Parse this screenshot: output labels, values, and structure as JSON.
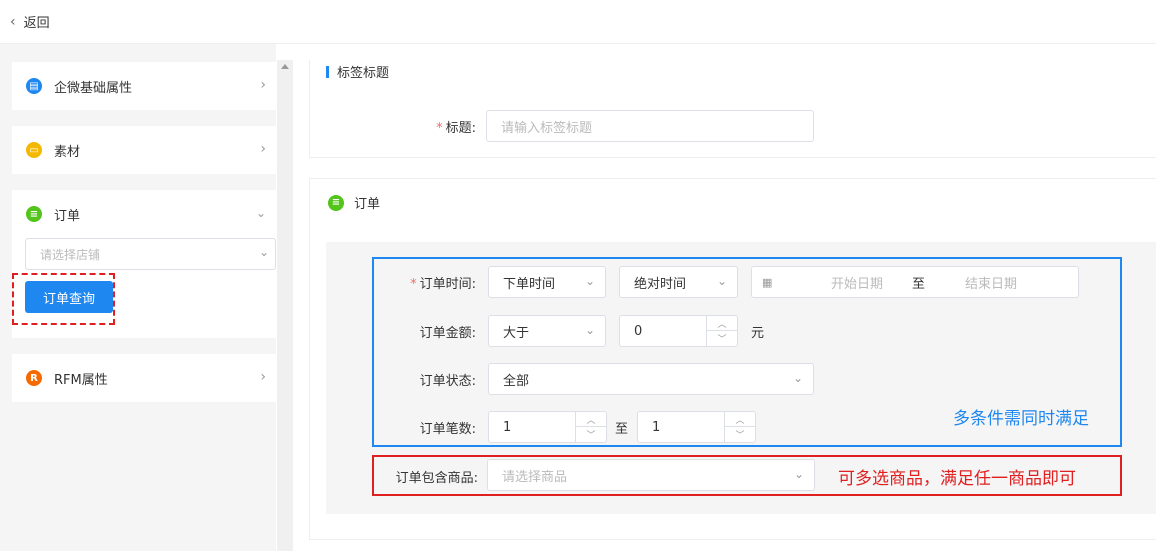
{
  "header": {
    "back_label": "返回"
  },
  "sidebar": {
    "cards": [
      {
        "label": "企微基础属性",
        "color": "#1e87f0"
      },
      {
        "label": "素材",
        "color": "#f5b800"
      },
      {
        "label": "订单",
        "color": "#52c41a"
      },
      {
        "label": "RFM属性",
        "color": "#f56a00",
        "icon_text": "R"
      }
    ],
    "shop_placeholder": "请选择店铺",
    "query_button": "订单查询"
  },
  "tag_section": {
    "title": "标签标题",
    "title_label": "标题:",
    "title_placeholder": "请输入标签标题"
  },
  "order_section": {
    "title": "订单",
    "time": {
      "label": "订单时间:",
      "type": "下单时间",
      "mode": "绝对时间",
      "start_placeholder": "开始日期",
      "sep": "至",
      "end_placeholder": "结束日期"
    },
    "amount": {
      "label": "订单金额:",
      "op": "大于",
      "value": "0",
      "unit": "元"
    },
    "status": {
      "label": "订单状态:",
      "value": "全部"
    },
    "count": {
      "label": "订单笔数:",
      "from": "1",
      "sep": "至",
      "to": "1"
    },
    "goods": {
      "label": "订单包含商品:",
      "placeholder": "请选择商品"
    },
    "annotation_blue": "多条件需同时满足",
    "annotation_red": "可多选商品，满足任一商品即可"
  }
}
